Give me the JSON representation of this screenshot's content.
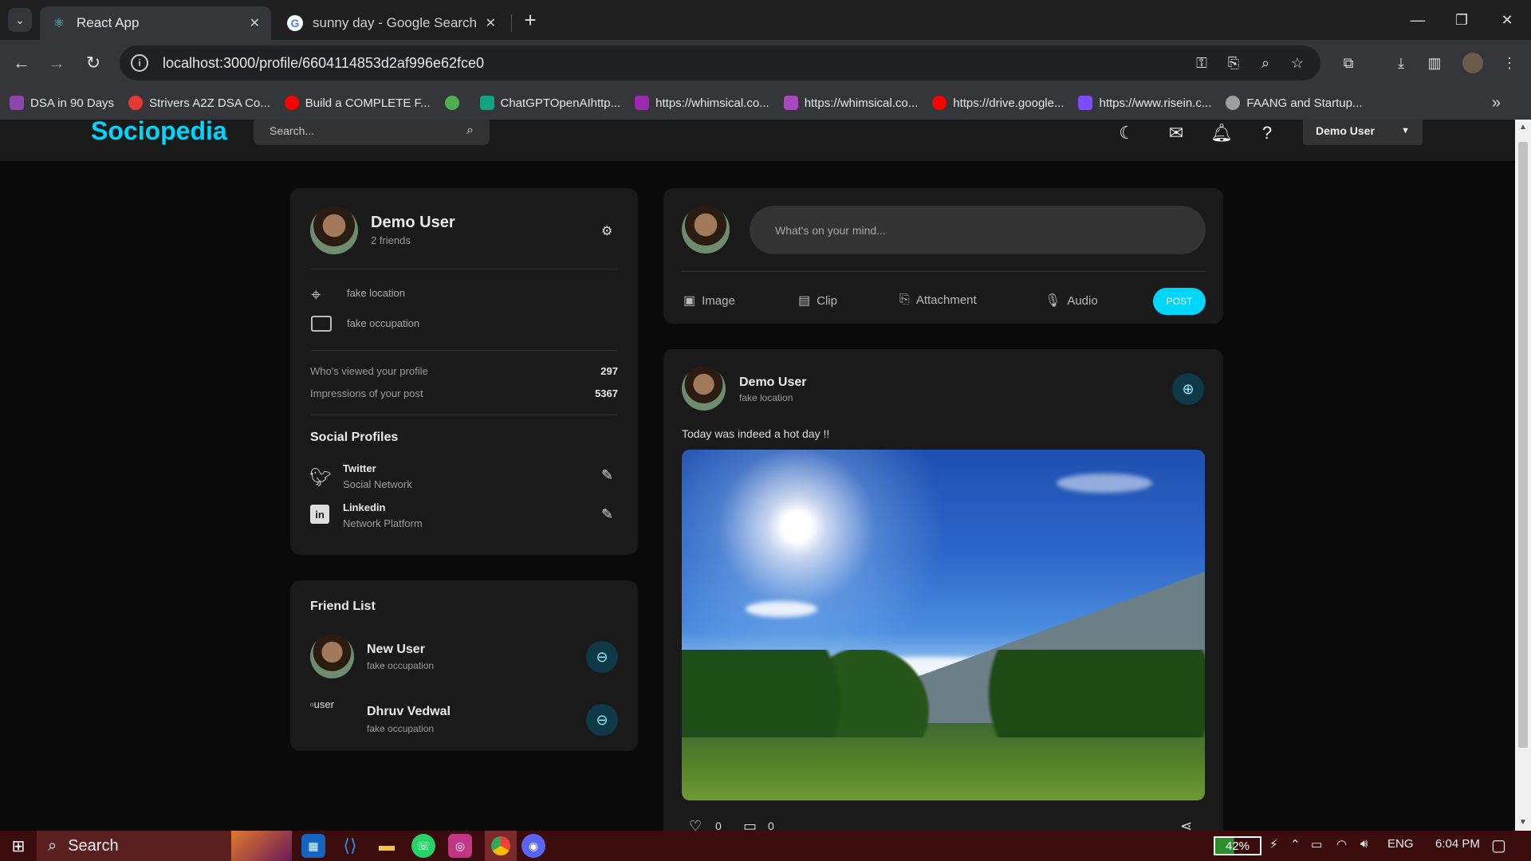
{
  "browser": {
    "tabs": [
      {
        "title": "React App",
        "active": true
      },
      {
        "title": "sunny day - Google Search",
        "active": false
      }
    ],
    "url": "localhost:3000/profile/6604114853d2af996e62fce0",
    "bookmarks": [
      {
        "label": "DSA in 90 Days",
        "color": "#8e44ad"
      },
      {
        "label": "Strivers A2Z DSA Co...",
        "color": "#e53935"
      },
      {
        "label": "Build a COMPLETE F...",
        "color": "#ff0000"
      },
      {
        "label": "",
        "color": "#4caf50"
      },
      {
        "label": "ChatGPTOpenAIhttp...",
        "color": "#10a37f"
      },
      {
        "label": "https://whimsical.co...",
        "color": "#9c27b0"
      },
      {
        "label": "https://whimsical.co...",
        "color": "#ab47bc"
      },
      {
        "label": "https://drive.google...",
        "color": "#ff0000"
      },
      {
        "label": "https://www.risein.c...",
        "color": "#7c4dff"
      },
      {
        "label": "FAANG and Startup...",
        "color": "#9e9e9e"
      }
    ]
  },
  "app": {
    "logo": "Sociopedia",
    "search_placeholder": "Search...",
    "user_menu": "Demo User",
    "accent": "#00d5fa"
  },
  "profile": {
    "name": "Demo User",
    "friends": "2 friends",
    "location": "fake location",
    "occupation": "fake occupation",
    "stats": [
      {
        "label": "Who's viewed your profile",
        "value": "297"
      },
      {
        "label": "Impressions of your post",
        "value": "5367"
      }
    ],
    "social_title": "Social Profiles",
    "socials": [
      {
        "name": "Twitter",
        "type": "Social Network"
      },
      {
        "name": "Linkedin",
        "type": "Network Platform"
      }
    ]
  },
  "friend_list": {
    "title": "Friend List",
    "friends": [
      {
        "name": "New User",
        "occupation": "fake occupation"
      },
      {
        "name": "Dhruv Vedwal",
        "occupation": "fake occupation",
        "alt": "user"
      }
    ]
  },
  "composer": {
    "placeholder": "What's on your mind...",
    "actions": [
      "Image",
      "Clip",
      "Attachment",
      "Audio"
    ],
    "post_label": "POST"
  },
  "post": {
    "author": "Demo User",
    "location": "fake location",
    "text": "Today was indeed a hot day !!",
    "likes": "0",
    "comments": "0"
  },
  "taskbar": {
    "search": "Search",
    "battery": "42%",
    "lang": "ENG",
    "time": "6:04 PM"
  }
}
